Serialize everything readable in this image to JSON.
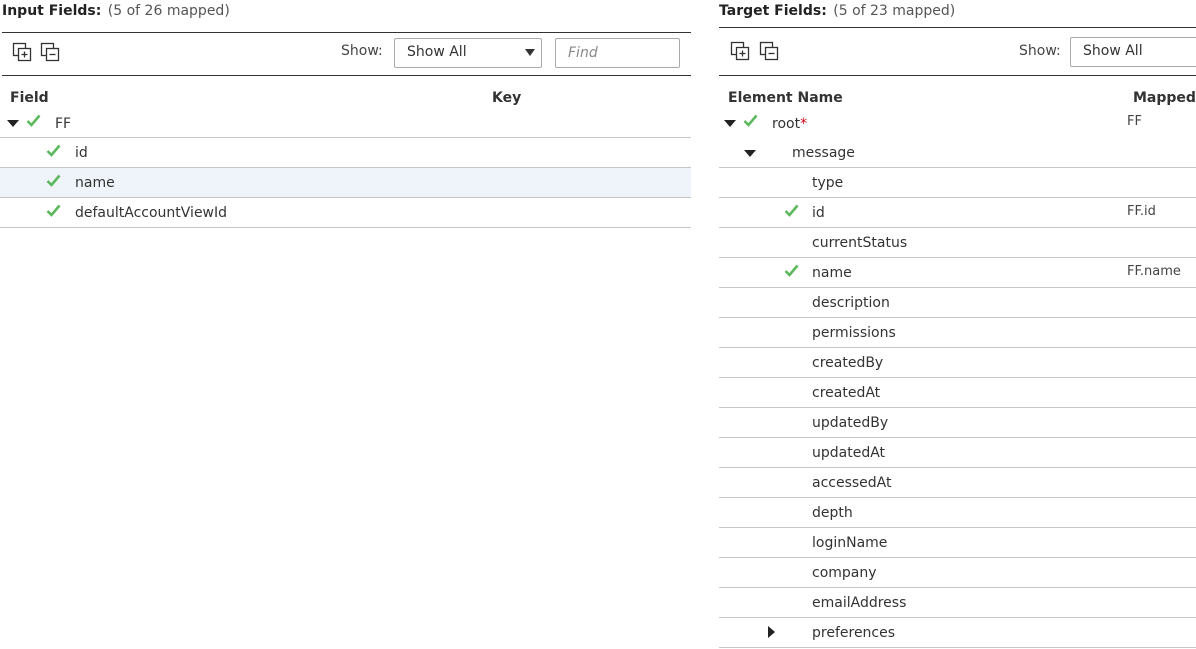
{
  "input_panel": {
    "title_label": "Input Fields:",
    "title_count": "(5 of 26 mapped)",
    "toolbar": {
      "expand_icon": "expand-all-icon",
      "collapse_icon": "collapse-all-icon",
      "show_label": "Show:",
      "show_value": "Show All",
      "find_placeholder": "Find",
      "find_value": ""
    },
    "columns": {
      "field": "Field",
      "key": "Key"
    },
    "rows": [
      {
        "name": "FF",
        "checked": true,
        "expanded": true,
        "highlighted": false
      },
      {
        "name": "id",
        "checked": true,
        "highlighted": false
      },
      {
        "name": "name",
        "checked": true,
        "highlighted": true
      },
      {
        "name": "defaultAccountViewId",
        "checked": true,
        "highlighted": false
      }
    ]
  },
  "target_panel": {
    "title_label": "Target Fields:",
    "title_count": "(5 of 23 mapped)",
    "toolbar": {
      "expand_icon": "expand-all-icon",
      "collapse_icon": "collapse-all-icon",
      "show_label": "Show:",
      "show_value": "Show All"
    },
    "columns": {
      "element": "Element Name",
      "mapped": "Mapped"
    },
    "rows": [
      {
        "name": "root",
        "required_marker": "*",
        "mapped": "FF",
        "checked": true,
        "expanded": true
      },
      {
        "name": "message",
        "mapped": "",
        "checked": false,
        "expanded": true
      },
      {
        "name": "type",
        "mapped": "",
        "checked": false
      },
      {
        "name": "id",
        "mapped": "FF.id",
        "checked": true
      },
      {
        "name": "currentStatus",
        "mapped": "",
        "checked": false
      },
      {
        "name": "name",
        "mapped": "FF.name",
        "checked": true
      },
      {
        "name": "description",
        "mapped": "",
        "checked": false
      },
      {
        "name": "permissions",
        "mapped": "",
        "checked": false
      },
      {
        "name": "createdBy",
        "mapped": "",
        "checked": false
      },
      {
        "name": "createdAt",
        "mapped": "",
        "checked": false
      },
      {
        "name": "updatedBy",
        "mapped": "",
        "checked": false
      },
      {
        "name": "updatedAt",
        "mapped": "",
        "checked": false
      },
      {
        "name": "accessedAt",
        "mapped": "",
        "checked": false
      },
      {
        "name": "depth",
        "mapped": "",
        "checked": false
      },
      {
        "name": "loginName",
        "mapped": "",
        "checked": false
      },
      {
        "name": "company",
        "mapped": "",
        "checked": false
      },
      {
        "name": "emailAddress",
        "mapped": "",
        "checked": false
      },
      {
        "name": "preferences",
        "mapped": "",
        "checked": false,
        "expanded": false
      }
    ]
  },
  "colors": {
    "check": "#5cb85c",
    "required": "#d0021b",
    "row_highlight": "#eef4fa",
    "divider": "#c6c6c6"
  }
}
